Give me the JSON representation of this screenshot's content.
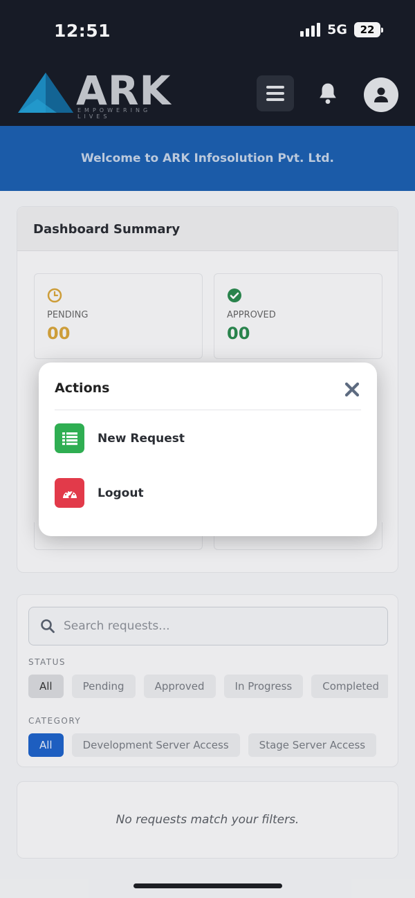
{
  "status_bar": {
    "time": "12:51",
    "network": "5G",
    "battery": "22"
  },
  "header": {
    "logo_text": "ARK",
    "logo_tagline": "EMPOWERING LIVES",
    "welcome": "Welcome to ARK Infosolution Pvt. Ltd."
  },
  "dashboard": {
    "title": "Dashboard Summary",
    "stats": [
      {
        "label": "PENDING",
        "value": "00",
        "color": "#d7a53a",
        "icon": "clock-icon"
      },
      {
        "label": "APPROVED",
        "value": "00",
        "color": "#2b8a4f",
        "icon": "check-circle-icon"
      }
    ]
  },
  "filters": {
    "search_placeholder": "Search requests...",
    "status_label": "STATUS",
    "status_options": [
      "All",
      "Pending",
      "Approved",
      "In Progress",
      "Completed"
    ],
    "category_label": "CATEGORY",
    "category_options": [
      "All",
      "Development Server Access",
      "Stage Server Access"
    ]
  },
  "empty_state": "No requests match your filters.",
  "modal": {
    "title": "Actions",
    "actions": [
      {
        "label": "New Request",
        "icon": "list-icon",
        "color": "#2fae52"
      },
      {
        "label": "Logout",
        "icon": "speedometer-icon",
        "color": "#e23a4a"
      }
    ]
  },
  "colors": {
    "header_bg": "#181c26",
    "welcome_bg": "#1c5faf",
    "accent_blue": "#1e63c9"
  }
}
